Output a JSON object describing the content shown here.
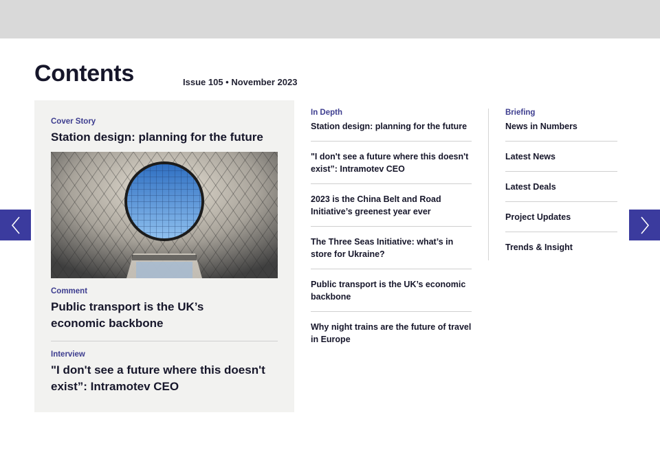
{
  "page": {
    "heading": "Contents",
    "issue": "Issue 105 • November 2023"
  },
  "feature": {
    "cover": {
      "kicker": "Cover Story",
      "title": "Station design: planning for the future"
    },
    "comment": {
      "kicker": "Comment",
      "title": "Public transport is the UK’s economic backbone"
    },
    "interview": {
      "kicker": "Interview",
      "title": "\"I don't see a future where this doesn't exist”: Intramotev CEO"
    }
  },
  "in_depth": {
    "kicker": "In Depth",
    "items": [
      "Station design: planning for the future",
      "\"I don't see a future where this doesn't exist”: Intramotev CEO",
      "2023 is the China Belt and Road Initiative’s greenest year ever",
      "The Three Seas Initiative: what’s in store for Ukraine?",
      "Public transport is the UK’s economic backbone",
      "Why night trains are the future of travel in Europe"
    ]
  },
  "briefing": {
    "kicker": "Briefing",
    "items": [
      "News in Numbers",
      "Latest News",
      "Latest Deals",
      "Project Updates",
      "Trends & Insight"
    ]
  },
  "icons": {
    "prev": "chevron-left-icon",
    "next": "chevron-right-icon"
  },
  "colors": {
    "accent": "#3b3b9e",
    "kicker": "#3d3d8f",
    "panel": "#f2f2f0",
    "top_bar": "#d9d9d9"
  }
}
